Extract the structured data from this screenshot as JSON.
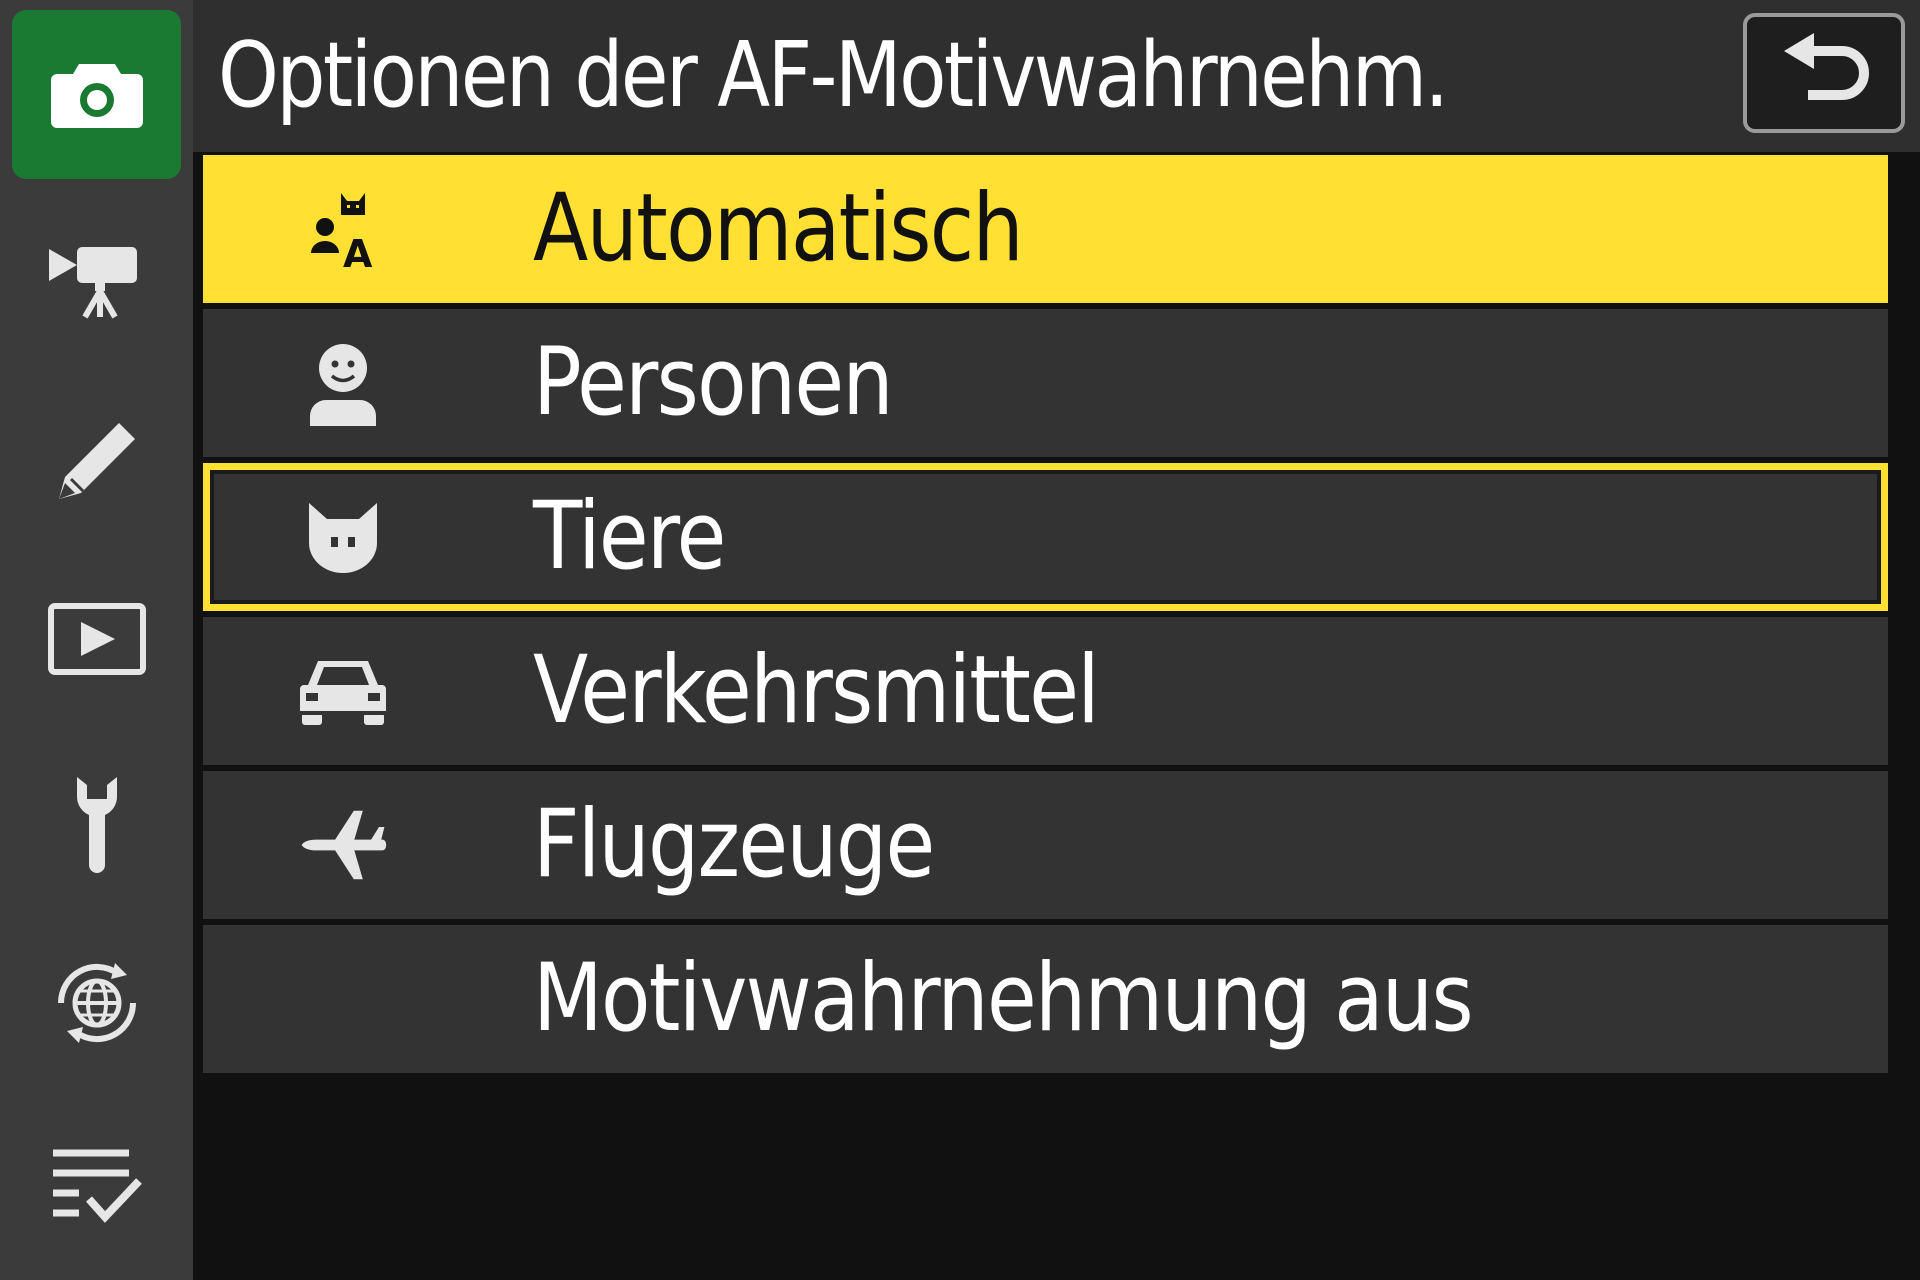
{
  "header": {
    "title": "Optionen der AF-Motivwahrnehm.",
    "back_icon": "return-arrow-icon"
  },
  "sidebar": {
    "tabs": [
      {
        "icon": "camera-icon",
        "active": true
      },
      {
        "icon": "movie-camera-icon",
        "active": false
      },
      {
        "icon": "pencil-icon",
        "active": false
      },
      {
        "icon": "playback-icon",
        "active": false
      },
      {
        "icon": "wrench-icon",
        "active": false
      },
      {
        "icon": "network-globe-icon",
        "active": false
      },
      {
        "icon": "checklist-icon",
        "active": false
      }
    ]
  },
  "menu": {
    "items": [
      {
        "label": "Automatisch",
        "icon": "auto-subject-icon",
        "state": "highlighted"
      },
      {
        "label": "Personen",
        "icon": "person-icon",
        "state": "normal"
      },
      {
        "label": "Tiere",
        "icon": "animal-icon",
        "state": "selected"
      },
      {
        "label": "Verkehrsmittel",
        "icon": "vehicle-icon",
        "state": "normal"
      },
      {
        "label": "Flugzeuge",
        "icon": "airplane-icon",
        "state": "normal"
      },
      {
        "label": "Motivwahrnehmung aus",
        "icon": "",
        "state": "normal"
      }
    ]
  },
  "colors": {
    "highlight": "#ffe033",
    "active_tab": "#1a7a31",
    "row": "#333333",
    "sidebar": "#3b3b3b"
  }
}
